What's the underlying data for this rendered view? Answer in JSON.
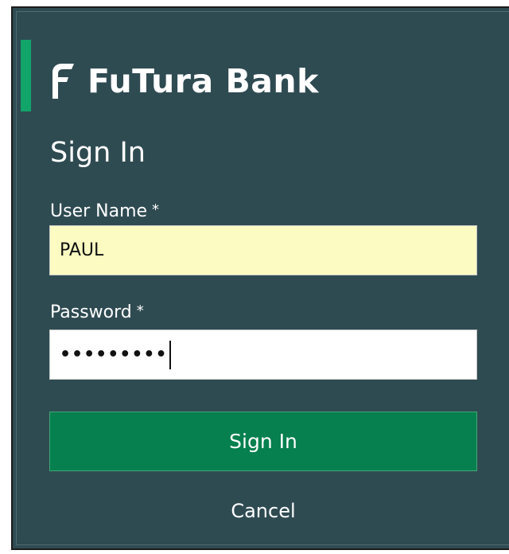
{
  "brand": {
    "name": "FuTura Bank",
    "logo_icon": "futura-f-logo"
  },
  "form": {
    "title": "Sign In",
    "username": {
      "label": "User Name",
      "required_mark": "*",
      "value": "PAUL"
    },
    "password": {
      "label": "Password",
      "required_mark": "*",
      "masked_value": "•••••••••"
    },
    "submit_label": "Sign In",
    "cancel_label": "Cancel"
  },
  "colors": {
    "panel_background": "#2f4b52",
    "accent_bar": "#11a56a",
    "primary_button": "#05804e",
    "username_field_background": "#fbfbc2"
  }
}
